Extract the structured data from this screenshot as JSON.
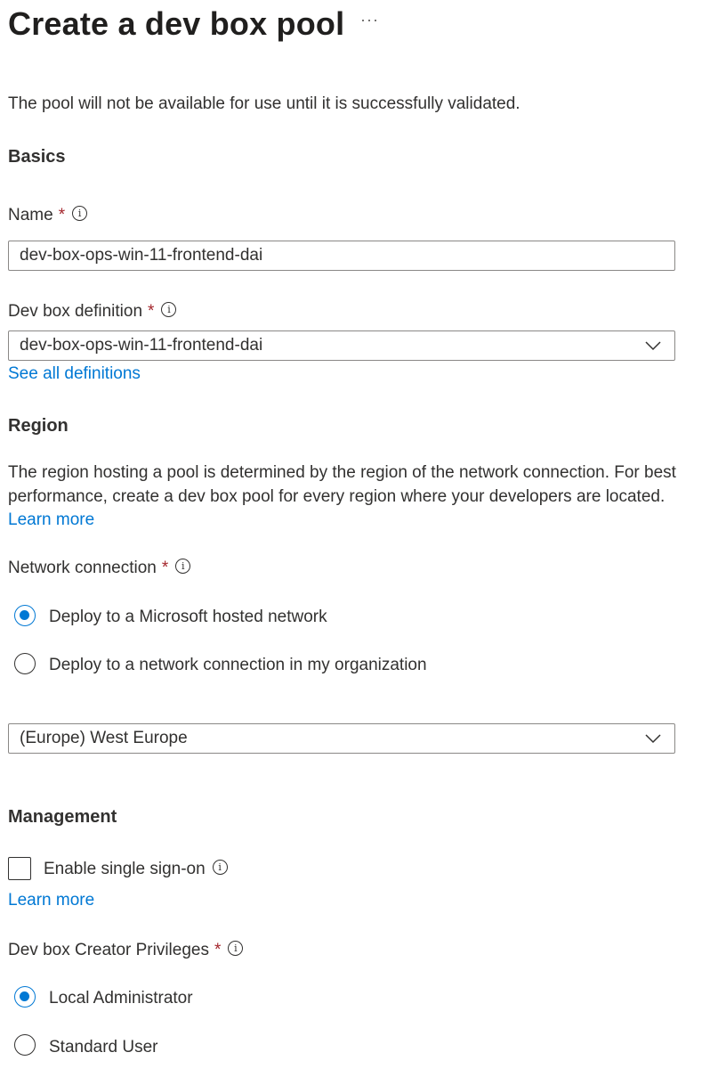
{
  "header": {
    "title": "Create a dev box pool",
    "more": "···"
  },
  "intro": "The pool will not be available for use until it is successfully validated.",
  "basics": {
    "heading": "Basics",
    "name_label": "Name",
    "name_value": "dev-box-ops-win-11-frontend-dai",
    "definition_label": "Dev box definition",
    "definition_value": "dev-box-ops-win-11-frontend-dai",
    "see_all_link": "See all definitions"
  },
  "region": {
    "heading": "Region",
    "description": "The region hosting a pool is determined by the region of the network connection. For best performance, create a dev box pool for every region where your developers are located.",
    "learn_more": "Learn more",
    "network_label": "Network connection",
    "options": [
      {
        "label": "Deploy to a Microsoft hosted network",
        "selected": true
      },
      {
        "label": "Deploy to a network connection in my organization",
        "selected": false
      }
    ],
    "region_value": "(Europe) West Europe"
  },
  "management": {
    "heading": "Management",
    "sso_label": "Enable single sign-on",
    "sso_checked": false,
    "learn_more": "Learn more",
    "privileges_label": "Dev box Creator Privileges",
    "privilege_options": [
      {
        "label": "Local Administrator",
        "selected": true
      },
      {
        "label": "Standard User",
        "selected": false
      }
    ]
  },
  "common": {
    "required": "*",
    "info_glyph": "i"
  },
  "colors": {
    "accent": "#0078d4",
    "required": "#a4262c",
    "text": "#323130"
  }
}
